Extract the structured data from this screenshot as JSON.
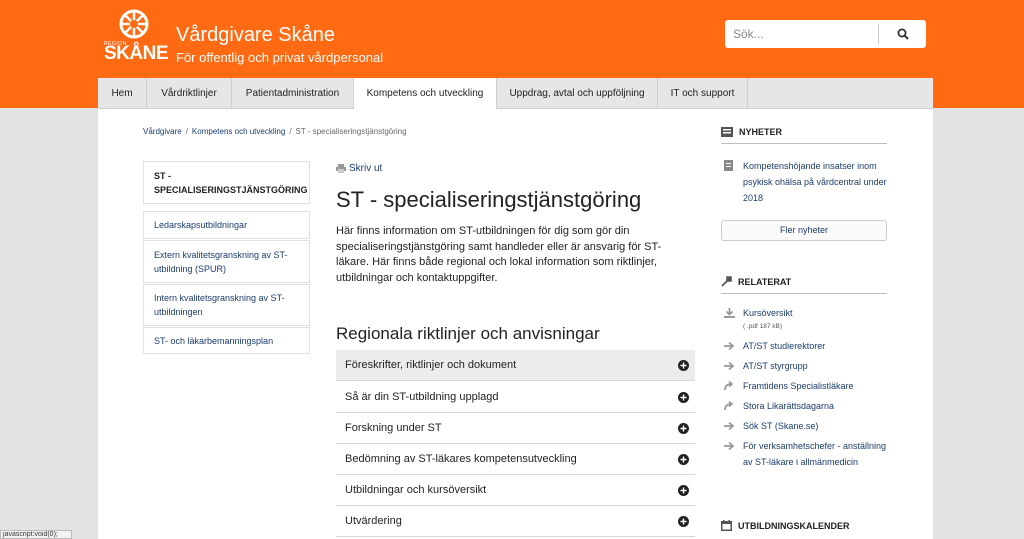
{
  "header": {
    "logo_small": "REGION",
    "logo_text": "SKÅNE",
    "title": "Vårdgivare Skåne",
    "subtitle": "För offentlig och privat vårdpersonal",
    "search_placeholder": "Sök..."
  },
  "nav": [
    {
      "label": "Hem"
    },
    {
      "label": "Vårdriktlinjer"
    },
    {
      "label": "Patientadministration"
    },
    {
      "label": "Kompetens och utveckling",
      "active": true
    },
    {
      "label": "Uppdrag, avtal och uppföljning"
    },
    {
      "label": "IT och support"
    }
  ],
  "breadcrumb": [
    "Vårdgivare",
    "Kompetens och utveckling",
    "ST - specialiseringstjänstgöring"
  ],
  "left_nav": {
    "current": "ST - specialiseringstjänstgöring",
    "items": [
      "Ledarskapsutbildningar",
      "Extern kvalitetsgranskning av ST-utbildning (SPUR)",
      "Intern kvalitetsgranskning av ST-utbildningen",
      "ST- och läkarbemanningsplan"
    ]
  },
  "main": {
    "print_label": "Skriv ut",
    "title": "ST - specialiseringstjänstgöring",
    "intro": "Här finns information om ST-utbildningen för dig som gör din specialiseringstjänstgöring samt handleder eller är ansvarig för ST-läkare. Här finns både regional och lokal information som riktlinjer, utbildningar och kontaktuppgifter.",
    "section_title": "Regionala riktlinjer och anvisningar",
    "accordion": [
      "Föreskrifter, riktlinjer och dokument",
      "Så är din ST-utbildning upplagd",
      "Forskning under ST",
      "Bedömning av ST-läkares kompetensutveckling",
      "Utbildningar och kursöversikt",
      "Utvärdering"
    ]
  },
  "right": {
    "news_heading": "NYHETER",
    "news_item": "Kompetenshöjande insatser inom psykisk ohälsa på vårdcentral under 2018",
    "more_news": "Fler nyheter",
    "related_heading": "RELATERAT",
    "related": [
      {
        "label": "Kursöversikt",
        "icon": "download-icon",
        "meta": "( .pdf 187 kB)"
      },
      {
        "label": "AT/ST studierektorer",
        "icon": "arrow-right-icon"
      },
      {
        "label": "AT/ST styrgrupp",
        "icon": "arrow-right-icon"
      },
      {
        "label": "Framtidens Specialistläkare",
        "icon": "external-link-icon"
      },
      {
        "label": "Stora Likarättsdagarna",
        "icon": "external-link-icon"
      },
      {
        "label": "Sök ST (Skane.se)",
        "icon": "arrow-right-icon"
      },
      {
        "label": "För verksamhetschefer - anställning av ST-läkare i allmänmedicin",
        "icon": "arrow-right-icon"
      }
    ],
    "calendar_heading": "UTBILDNINGSKALENDER"
  },
  "status_bar": "javascript:void(0);",
  "colors": {
    "brand": "#ff6a13",
    "link": "#1a3d6e",
    "background": "#e3e3e3"
  }
}
